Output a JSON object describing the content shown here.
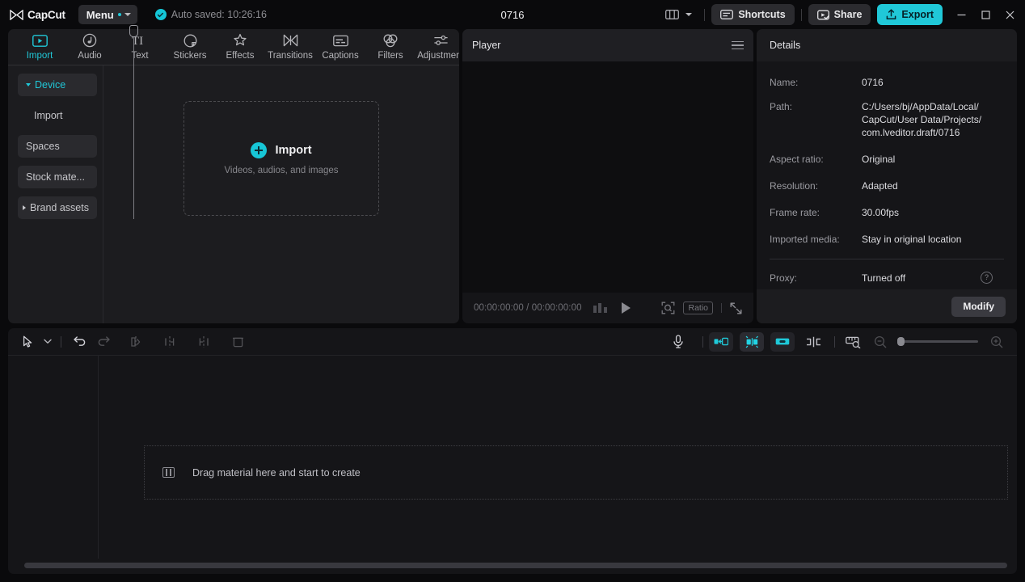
{
  "titlebar": {
    "brand": "CapCut",
    "menu_label": "Menu",
    "autosave_text": "Auto saved: 10:26:16",
    "project_title": "0716",
    "layout_icon": "layout-panels-icon",
    "shortcuts_label": "Shortcuts",
    "share_label": "Share",
    "export_label": "Export",
    "minimize_icon": "minimize-icon",
    "maximize_icon": "maximize-icon",
    "close_icon": "close-icon"
  },
  "tabs": [
    {
      "label": "Import",
      "icon": "import-video-icon",
      "active": true
    },
    {
      "label": "Audio",
      "icon": "audio-note-icon",
      "active": false
    },
    {
      "label": "Text",
      "icon": "text-ti-icon",
      "active": false
    },
    {
      "label": "Stickers",
      "icon": "sticker-icon",
      "active": false
    },
    {
      "label": "Effects",
      "icon": "effects-sparkle-icon",
      "active": false
    },
    {
      "label": "Transitions",
      "icon": "transitions-bowtie-icon",
      "active": false
    },
    {
      "label": "Captions",
      "icon": "captions-icon",
      "active": false
    },
    {
      "label": "Filters",
      "icon": "filters-circles-icon",
      "active": false
    },
    {
      "label": "Adjustment",
      "icon": "adjustment-sliders-icon",
      "active": false
    }
  ],
  "sidebar": {
    "items": [
      {
        "label": "Device",
        "state": "expanded",
        "active": true,
        "boxed": true
      },
      {
        "label": "Import",
        "state": "child",
        "active": false,
        "boxed": false
      },
      {
        "label": "Spaces",
        "state": "plain",
        "active": false,
        "boxed": true
      },
      {
        "label": "Stock mate...",
        "state": "plain",
        "active": false,
        "boxed": true
      },
      {
        "label": "Brand assets",
        "state": "collapsed",
        "active": false,
        "boxed": true
      }
    ]
  },
  "dropzone": {
    "icon": "plus-circle-icon",
    "title": "Import",
    "subtitle": "Videos, audios, and images"
  },
  "player": {
    "title": "Player",
    "menu_icon": "hamburger-menu-icon",
    "current_time": "00:00:00:00",
    "separator": "/",
    "total_time": "00:00:00:00",
    "timecode": "00:00:00:00 / 00:00:00:00",
    "keyframe_icon": "keyframe-bars-icon",
    "play_icon": "play-icon",
    "fit_icon": "zoom-fit-icon",
    "ratio_label": "Ratio",
    "fullscreen_icon": "fullscreen-icon"
  },
  "details": {
    "title": "Details",
    "rows": [
      {
        "label": "Name:",
        "value": "0716",
        "lines": [
          "0716"
        ]
      },
      {
        "label": "Path:",
        "value": "C:/Users/bj/AppData/Local/CapCut/User Data/Projects/com.lveditor.draft/0716",
        "lines": [
          "C:/Users/bj/AppData/Local/",
          "CapCut/User Data/Projects/",
          "com.lveditor.draft/0716"
        ]
      },
      {
        "label": "Aspect ratio:",
        "value": "Original",
        "lines": [
          "Original"
        ]
      },
      {
        "label": "Resolution:",
        "value": "Adapted",
        "lines": [
          "Adapted"
        ]
      },
      {
        "label": "Frame rate:",
        "value": "30.00fps",
        "lines": [
          "30.00fps"
        ]
      },
      {
        "label": "Imported media:",
        "value": "Stay in original location",
        "lines": [
          "Stay in original location"
        ]
      }
    ],
    "proxy_label": "Proxy:",
    "proxy_value": "Turned off",
    "help_icon": "help-question-icon",
    "help_glyph": "?",
    "modify_label": "Modify"
  },
  "timeline": {
    "tools": [
      {
        "name": "select-cursor",
        "icon": "cursor-arrow-icon",
        "enabled": true
      },
      {
        "name": "cursor-dropdown",
        "icon": "chevron-down-icon",
        "enabled": true
      },
      {
        "name": "undo",
        "icon": "undo-arrow-icon",
        "enabled": true
      },
      {
        "name": "redo",
        "icon": "redo-arrow-icon",
        "enabled": false
      },
      {
        "name": "split",
        "icon": "split-icon",
        "enabled": false
      },
      {
        "name": "trim-left",
        "icon": "trim-left-icon",
        "enabled": false
      },
      {
        "name": "trim-right",
        "icon": "trim-right-icon",
        "enabled": false
      },
      {
        "name": "delete",
        "icon": "delete-trash-icon",
        "enabled": false
      }
    ],
    "right_tools": [
      {
        "name": "record-voiceover",
        "icon": "microphone-icon",
        "active": false
      },
      {
        "name": "auto-adjust-left",
        "icon": "clip-snap-left-icon",
        "active": false
      },
      {
        "name": "auto-snap",
        "icon": "magnet-snap-icon",
        "active": true
      },
      {
        "name": "link-clips",
        "icon": "clip-link-icon",
        "active": false
      },
      {
        "name": "keyframe-marker",
        "icon": "marker-split-icon",
        "active": false
      },
      {
        "name": "ruler-zoom",
        "icon": "ruler-magnify-icon",
        "active": false
      },
      {
        "name": "zoom-out",
        "icon": "zoom-out-icon",
        "active": false
      },
      {
        "name": "zoom-in",
        "icon": "zoom-in-icon",
        "active": false
      }
    ],
    "drop_icon": "film-strip-icon",
    "drop_text": "Drag material here and start to create",
    "zoom_value": 0,
    "playhead_position": "00:00:00:00"
  },
  "colors": {
    "accent": "#20c8d8",
    "export_bg": "#20c8d8",
    "panel_bg": "#1c1c1f",
    "stage_bg": "#0e0e10",
    "window_bg": "#0a0a0c"
  }
}
